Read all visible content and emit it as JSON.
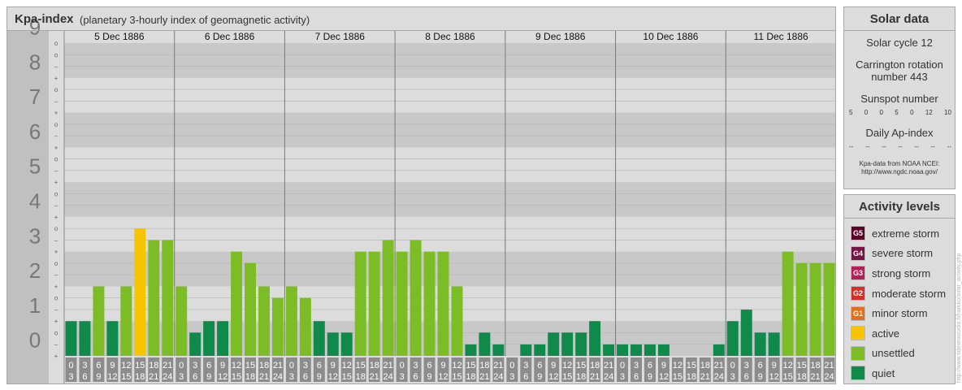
{
  "header": {
    "title": "Kpa-index",
    "subtitle": "(planetary 3-hourly index of geomagnetic activity)"
  },
  "chart_data": {
    "type": "bar",
    "days": [
      "5 Dec 1886",
      "6 Dec 1886",
      "7 Dec 1886",
      "8 Dec 1886",
      "9 Dec 1886",
      "10 Dec 1886",
      "11 Dec 1886"
    ],
    "interval_start_hours": [
      "0",
      "3",
      "6",
      "9",
      "12",
      "15",
      "18",
      "21"
    ],
    "interval_end_hours": [
      "3",
      "6",
      "9",
      "12",
      "15",
      "18",
      "21",
      "24"
    ],
    "values": [
      1.0,
      1.0,
      2.0,
      1.0,
      2.0,
      3.67,
      3.33,
      3.33,
      2.0,
      0.67,
      1.0,
      1.0,
      3.0,
      2.67,
      2.0,
      1.67,
      2.0,
      1.67,
      1.0,
      0.67,
      0.67,
      3.0,
      3.0,
      3.33,
      3.0,
      3.33,
      3.0,
      3.0,
      2.0,
      0.33,
      0.67,
      0.33,
      0.0,
      0.33,
      0.33,
      0.67,
      0.67,
      0.67,
      1.0,
      0.33,
      0.33,
      0.33,
      0.33,
      0.33,
      0.0,
      0.0,
      0.0,
      0.33,
      1.0,
      1.33,
      0.67,
      0.67,
      3.0,
      2.67,
      2.67,
      2.67
    ],
    "ylim": [
      0,
      9
    ],
    "y_ticks": [
      "0",
      "1",
      "2",
      "3",
      "4",
      "5",
      "6",
      "7",
      "8",
      "9"
    ],
    "minor_labels": [
      "+",
      "–",
      "o"
    ],
    "minor_top_label": "o",
    "grid": true,
    "colors": {
      "quiet": "#108a4a",
      "unsettled": "#7cbd25",
      "active": "#f7c400",
      "panel_bg": "#dcdcdc",
      "band_dark": "#c8c8c8",
      "label_col": "#c0c0c0",
      "tick_box": "#8c8c8c"
    }
  },
  "solar": {
    "title": "Solar data",
    "cycle": "Solar cycle 12",
    "carrington_line1": "Carrington rotation",
    "carrington_line2": "number 443",
    "sunspot_title": "Sunspot number",
    "sunspot_values": [
      "5",
      "0",
      "0",
      "5",
      "0",
      "12",
      "10"
    ],
    "ap_title": "Daily Ap-index",
    "ap_values": [
      "--",
      "--",
      "--",
      "--",
      "--",
      "--",
      "--"
    ],
    "source_line1": "Kpa-data from NOAA NCEI:",
    "source_line2": "http://www.ngdc.noaa.gov/"
  },
  "activity": {
    "title": "Activity levels",
    "items": [
      {
        "badge": "G5",
        "label": "extreme storm",
        "color": "#5a0028"
      },
      {
        "badge": "G4",
        "label": "severe storm",
        "color": "#7a1445"
      },
      {
        "badge": "G3",
        "label": "strong storm",
        "color": "#b41e5a"
      },
      {
        "badge": "G2",
        "label": "moderate storm",
        "color": "#d3302a"
      },
      {
        "badge": "G1",
        "label": "minor storm",
        "color": "#e36f1e"
      },
      {
        "badge": "",
        "label": "active",
        "color": "#f7c400"
      },
      {
        "badge": "",
        "label": "unsettled",
        "color": "#7cbd25"
      },
      {
        "badge": "",
        "label": "quiet",
        "color": "#108a4a"
      }
    ]
  },
  "watermark": "http://www.tideseastudio.fi/harkko/solar_activity.php"
}
